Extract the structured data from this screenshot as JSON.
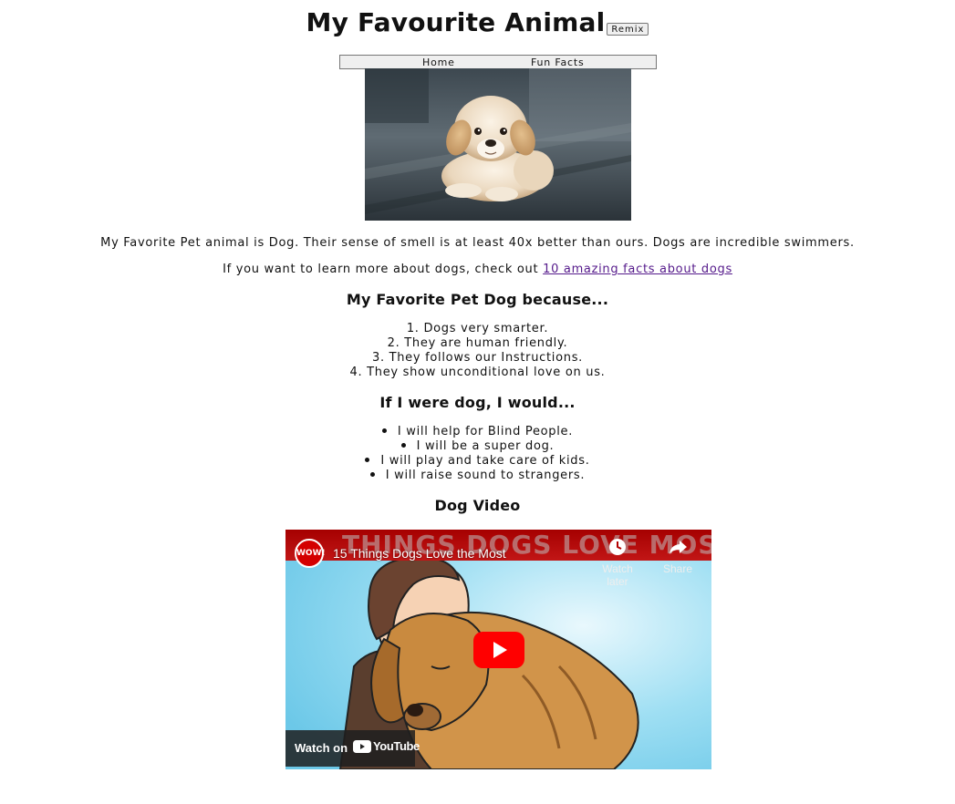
{
  "header": {
    "title": "My Favourite Animal",
    "remix_label": "Remix"
  },
  "nav": {
    "items": [
      {
        "label": "Home"
      },
      {
        "label": "Fun Facts"
      }
    ]
  },
  "intro": {
    "text": "My Favorite Pet animal is Dog. Their sense of smell is at least 40x better than ours. Dogs are incredible swimmers.",
    "learn_prefix": "If you want to learn more about dogs, check out ",
    "learn_link": "10 amazing facts about dogs"
  },
  "because": {
    "heading": "My Favorite Pet Dog because...",
    "items": [
      "1. Dogs very smarter.",
      "2. They are human friendly.",
      "3. They follows our Instructions.",
      "4. They show unconditional love on us."
    ]
  },
  "would": {
    "heading": "If I were dog, I would...",
    "items": [
      "I will help for Blind People.",
      "I will be a super dog.",
      "I will play and take care of kids.",
      "I will raise sound to strangers."
    ]
  },
  "video_section": {
    "heading": "Dog Video",
    "video": {
      "banner_text": "THINGS DOGS LOVE MOST",
      "channel_badge": "WOW!",
      "title": "15 Things Dogs Love the Most",
      "watch_later_label": "Watch later",
      "share_label": "Share",
      "watch_on_label": "Watch on",
      "youtube_word": "YouTube"
    }
  },
  "colors": {
    "link": "#551a8b",
    "video_banner": "#b30000",
    "play_button": "#ff0000"
  }
}
